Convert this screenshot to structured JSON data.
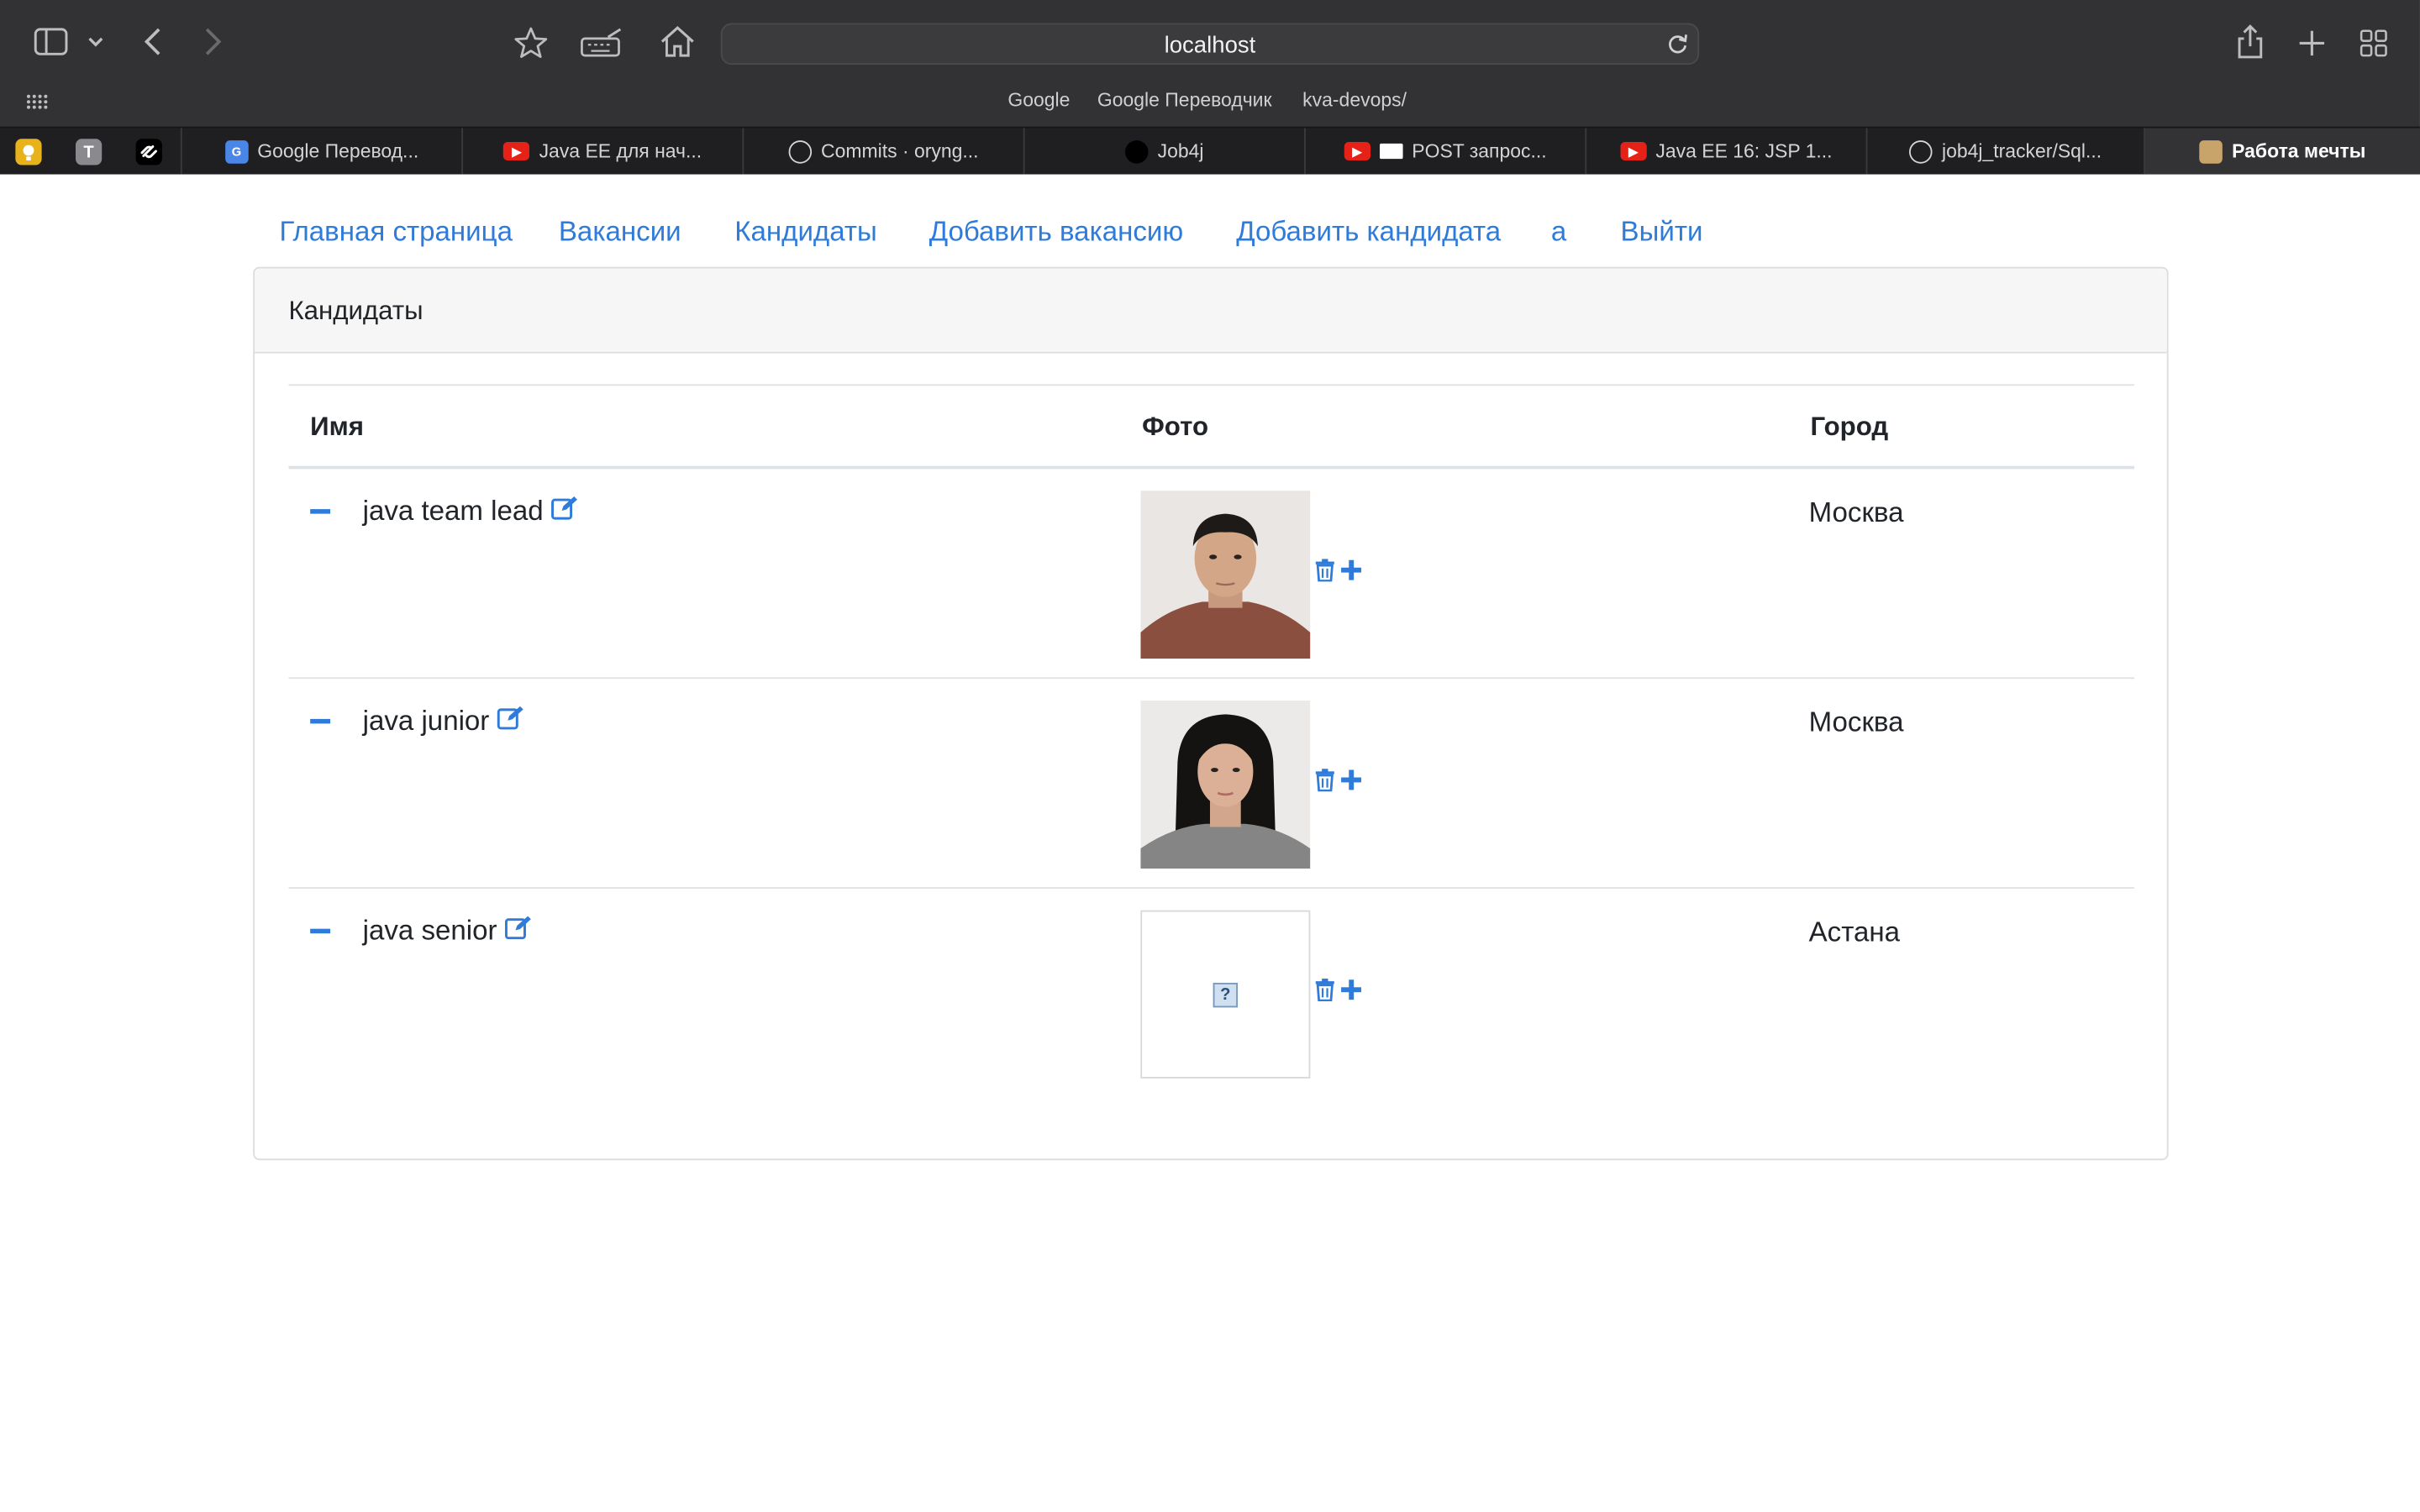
{
  "browser": {
    "address": "localhost",
    "bookmarks": [
      "Google",
      "Google Переводчик",
      "kva-devops/"
    ],
    "pinned_tabs": [
      "T"
    ],
    "tabs": [
      {
        "title": "Google Перевод..."
      },
      {
        "title": "Java EE для нач..."
      },
      {
        "title": "Commits · oryng..."
      },
      {
        "title": "Job4j"
      },
      {
        "title": "POST запрос..."
      },
      {
        "title": "Java EE 16: JSP 1..."
      },
      {
        "title": "job4j_tracker/Sql..."
      },
      {
        "title": "Работа мечты"
      }
    ]
  },
  "nav": {
    "items": [
      "Главная страница",
      "Вакансии",
      "Кандидаты",
      "Добавить вакансию",
      "Добавить кандидата",
      "a",
      "Выйти"
    ]
  },
  "card": {
    "title": "Кандидаты",
    "columns": [
      "Имя",
      "Фото",
      "Город"
    ],
    "rows": [
      {
        "name": "java team lead",
        "city": "Москва",
        "photo": "man-portrait"
      },
      {
        "name": "java junior",
        "city": "Москва",
        "photo": "woman-portrait"
      },
      {
        "name": "java senior",
        "city": "Астана",
        "photo": "broken-image",
        "broken_glyph": "?"
      }
    ]
  },
  "colors": {
    "link": "#2f7bd9",
    "chrome": "#323234",
    "tabbar": "#1f1f21"
  }
}
